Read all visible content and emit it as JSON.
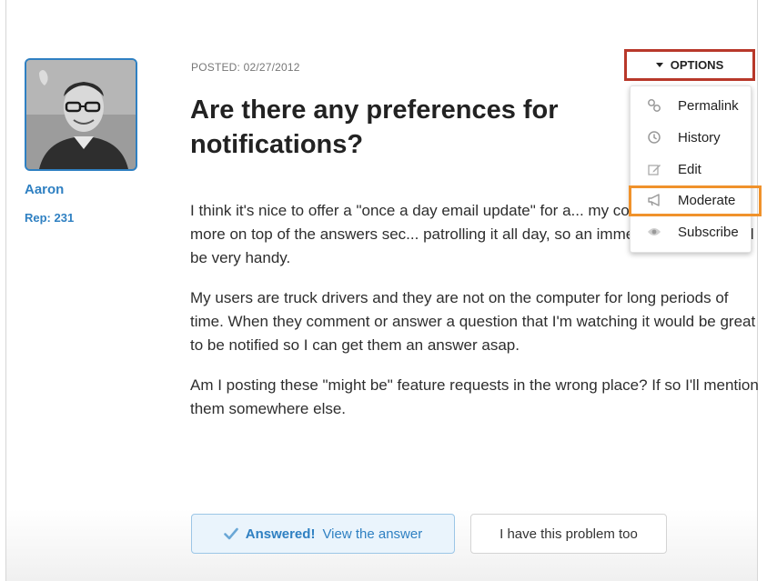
{
  "author": {
    "name": "Aaron",
    "rep": "Rep: 231",
    "avatar_icon": "user-photo-icon"
  },
  "post": {
    "posted": "POSTED: 02/27/2012",
    "title": "Are there any preferences for notifications?",
    "paragraphs": [
      "I think it's nice to offer a \"once a day email update\" for a... my company I like to be more on top of the answers sec... patrolling it all day, so an immediate email would be very handy.",
      "My users are truck drivers and they are not on the computer for long periods of time. When they comment or answer a question that I'm watching it would be great to be notified so I can get them an answer asap.",
      "Am I posting these \"might be\" feature requests in the wrong place? If so I'll mention them somewhere else."
    ]
  },
  "options": {
    "label": "OPTIONS",
    "items": [
      {
        "label": "Permalink",
        "icon": "link-icon"
      },
      {
        "label": "History",
        "icon": "clock-icon"
      },
      {
        "label": "Edit",
        "icon": "pencil-icon"
      },
      {
        "label": "Moderate",
        "icon": "megaphone-icon"
      },
      {
        "label": "Subscribe",
        "icon": "eye-icon"
      }
    ]
  },
  "actions": {
    "answered_strong": "Answered!",
    "answered_link": "View the answer",
    "problem_too": "I have this problem too"
  },
  "colors": {
    "accent": "#2f80c2",
    "options_highlight": "#b8382a",
    "moderate_highlight": "#f0922b"
  }
}
